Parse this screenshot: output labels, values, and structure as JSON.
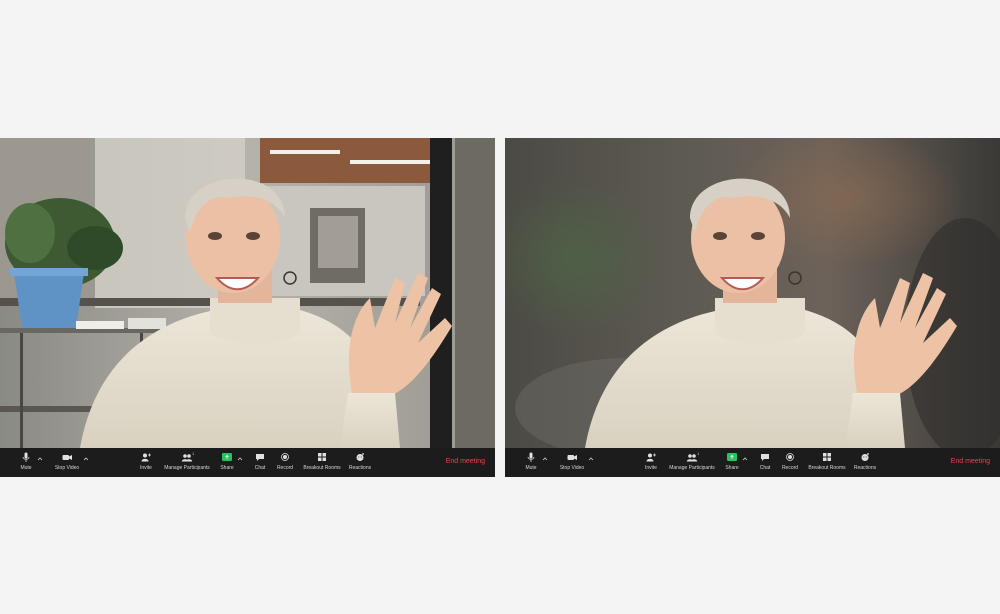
{
  "panels": [
    {
      "id": "original-background",
      "background": "office",
      "toolbar": {
        "mute_label": "Mute",
        "stop_video_label": "Stop Video",
        "invite_label": "Invite",
        "manage_participants_label": "Manage Participants",
        "participants_count": "1",
        "share_label": "Share",
        "chat_label": "Chat",
        "record_label": "Record",
        "breakout_rooms_label": "Breakout Rooms",
        "reactions_label": "Reactions",
        "end_meeting_label": "End meeting"
      }
    },
    {
      "id": "blurred-background",
      "background": "blurred",
      "toolbar": {
        "mute_label": "Mute",
        "stop_video_label": "Stop Video",
        "invite_label": "Invite",
        "manage_participants_label": "Manage Participants",
        "participants_count": "1",
        "share_label": "Share",
        "chat_label": "Chat",
        "record_label": "Record",
        "breakout_rooms_label": "Breakout Rooms",
        "reactions_label": "Reactions",
        "end_meeting_label": "End meeting"
      }
    }
  ],
  "colors": {
    "page_background": "#f4f4f4",
    "toolbar_background": "#1c1c1c",
    "toolbar_text": "#d6d6d6",
    "share_green": "#22c55e",
    "end_meeting_red": "#e8454a"
  },
  "icons": [
    "microphone-icon",
    "video-camera-icon",
    "invite-icon",
    "participants-icon",
    "share-screen-icon",
    "chat-icon",
    "record-icon",
    "breakout-rooms-icon",
    "reactions-icon",
    "chevron-up-icon"
  ]
}
